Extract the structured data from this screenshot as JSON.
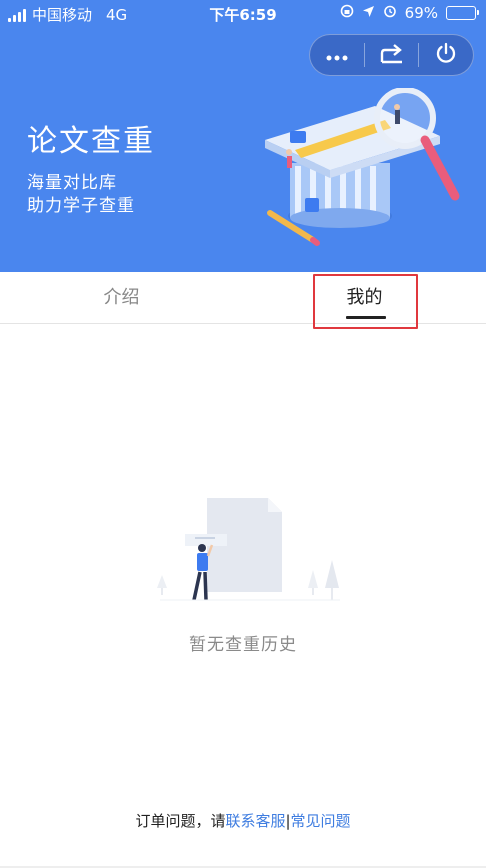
{
  "status": {
    "carrier": "中国移动",
    "network": "4G",
    "time": "下午6:59",
    "battery": "69%",
    "battery_level": 0.69
  },
  "header": {
    "title": "论文查重",
    "subtitle_line1": "海量对比库",
    "subtitle_line2": "助力学子查重",
    "background_color": "#4a86ee"
  },
  "capsule": {
    "more_icon": "more-dots-icon",
    "share_icon": "share-icon",
    "close_icon": "power-icon"
  },
  "tabs": [
    {
      "label": "介绍",
      "active": false
    },
    {
      "label": "我的",
      "active": true
    }
  ],
  "empty": {
    "message": "暂无查重历史"
  },
  "footer": {
    "prefix": "订单问题，请",
    "contact_link": "联系客服",
    "separator": "|",
    "faq_link": "常见问题"
  },
  "accent_color": "#3f7de0",
  "highlight_color": "#e0383e"
}
